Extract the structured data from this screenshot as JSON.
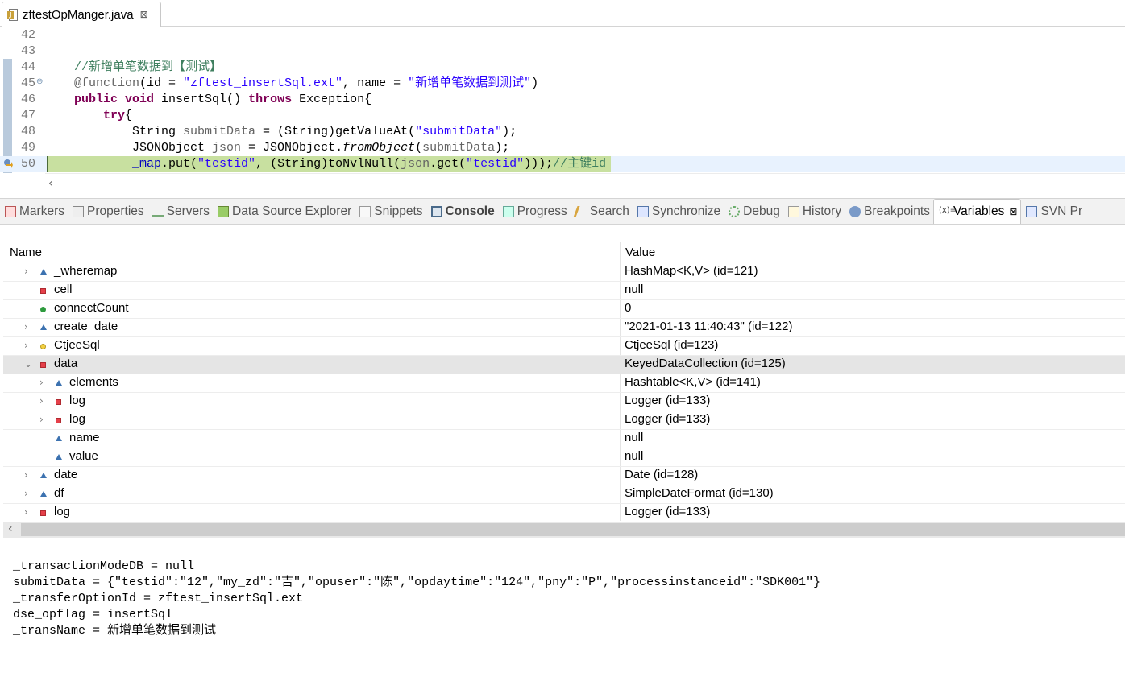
{
  "editor": {
    "tab_title": "zftestOpManger.java",
    "tab_close": "⊠"
  },
  "code": [
    {
      "ln": "42",
      "segments": []
    },
    {
      "ln": "43",
      "segments": []
    },
    {
      "ln": "44",
      "segments": [
        {
          "c": "cmt",
          "t": "//新增单笔数据到【测试】"
        }
      ]
    },
    {
      "ln": "45",
      "fold": "⊖",
      "segments": [
        {
          "c": "ann",
          "t": "@function"
        },
        {
          "c": "",
          "t": "(id = "
        },
        {
          "c": "str",
          "t": "\"zftest_insertSql.ext\""
        },
        {
          "c": "",
          "t": ", name = "
        },
        {
          "c": "str",
          "t": "\"新增单笔数据到测试\""
        },
        {
          "c": "",
          "t": ")"
        }
      ]
    },
    {
      "ln": "46",
      "segments": [
        {
          "c": "kw",
          "t": "public"
        },
        {
          "c": "",
          "t": " "
        },
        {
          "c": "kw",
          "t": "void"
        },
        {
          "c": "",
          "t": " insertSql() "
        },
        {
          "c": "kw",
          "t": "throws"
        },
        {
          "c": "",
          "t": " Exception{"
        }
      ]
    },
    {
      "ln": "47",
      "segments": [
        {
          "c": "",
          "t": "    "
        },
        {
          "c": "kw",
          "t": "try"
        },
        {
          "c": "",
          "t": "{"
        }
      ]
    },
    {
      "ln": "48",
      "segments": [
        {
          "c": "",
          "t": "        String "
        },
        {
          "c": "ann",
          "t": "submitData"
        },
        {
          "c": "",
          "t": " = (String)getValueAt("
        },
        {
          "c": "str",
          "t": "\"submitData\""
        },
        {
          "c": "",
          "t": ");"
        }
      ]
    },
    {
      "ln": "49",
      "segments": [
        {
          "c": "",
          "t": "        JSONObject "
        },
        {
          "c": "ann",
          "t": "json"
        },
        {
          "c": "",
          "t": " = JSONObject."
        },
        {
          "c": "itl",
          "t": "fromObject"
        },
        {
          "c": "",
          "t": "("
        },
        {
          "c": "ann",
          "t": "submitData"
        },
        {
          "c": "",
          "t": ");"
        }
      ]
    },
    {
      "ln": "50",
      "current": true,
      "segments": [
        {
          "c": "",
          "t": "        "
        },
        {
          "c": "fld",
          "t": "_map"
        },
        {
          "c": "",
          "t": ".put("
        },
        {
          "c": "str",
          "t": "\"testid\""
        },
        {
          "c": "",
          "t": ", (String)toNvlNull("
        },
        {
          "c": "ann",
          "t": "json"
        },
        {
          "c": "",
          "t": ".get("
        },
        {
          "c": "str",
          "t": "\"testid\""
        },
        {
          "c": "",
          "t": ")));"
        },
        {
          "c": "cmt",
          "t": "//主键id"
        }
      ]
    }
  ],
  "views": {
    "tabs": [
      {
        "label": "Markers",
        "icon": "markers-icon",
        "cls": "vi-markers"
      },
      {
        "label": "Properties",
        "icon": "properties-icon",
        "cls": "vi-props"
      },
      {
        "label": "Servers",
        "icon": "servers-icon",
        "cls": "vi-servers"
      },
      {
        "label": "Data Source Explorer",
        "icon": "data-source-icon",
        "cls": "vi-dse"
      },
      {
        "label": "Snippets",
        "icon": "snippets-icon",
        "cls": "vi-snip"
      },
      {
        "label": "Console",
        "icon": "console-icon",
        "cls": "vi-console",
        "bold": true
      },
      {
        "label": "Progress",
        "icon": "progress-icon",
        "cls": "vi-progress"
      },
      {
        "label": "Search",
        "icon": "search-icon",
        "cls": "vi-search"
      },
      {
        "label": "Synchronize",
        "icon": "synchronize-icon",
        "cls": "vi-sync"
      },
      {
        "label": "Debug",
        "icon": "debug-icon",
        "cls": "vi-debug"
      },
      {
        "label": "History",
        "icon": "history-icon",
        "cls": "vi-history"
      },
      {
        "label": "Breakpoints",
        "icon": "breakpoints-icon",
        "cls": "vi-bp"
      },
      {
        "label": "Variables",
        "icon": "variables-icon",
        "cls": "vi-vars",
        "glyph": "(x)=",
        "active": true,
        "close": "⊠"
      },
      {
        "label": "SVN Pr",
        "icon": "svn-icon",
        "cls": "vi-svn"
      }
    ]
  },
  "variables": {
    "col_name": "Name",
    "col_value": "Value",
    "rows": [
      {
        "depth": 0,
        "twisty": "›",
        "icon": "tri",
        "name": "_wheremap",
        "value": "HashMap<K,V>  (id=121)"
      },
      {
        "depth": 0,
        "twisty": "",
        "icon": "sq",
        "name": "cell",
        "value": "null"
      },
      {
        "depth": 0,
        "twisty": "",
        "icon": "dot",
        "name": "connectCount",
        "value": "0"
      },
      {
        "depth": 0,
        "twisty": "›",
        "icon": "tri",
        "name": "create_date",
        "value": "\"2021-01-13 11:40:43\" (id=122)"
      },
      {
        "depth": 0,
        "twisty": "›",
        "icon": "pdot",
        "name": "CtjeeSql",
        "value": "CtjeeSql  (id=123)"
      },
      {
        "depth": 0,
        "twisty": "⌄",
        "icon": "sq",
        "name": "data",
        "value": "KeyedDataCollection  (id=125)",
        "selected": true
      },
      {
        "depth": 1,
        "twisty": "›",
        "icon": "tri",
        "name": "elements",
        "value": "Hashtable<K,V>  (id=141)"
      },
      {
        "depth": 1,
        "twisty": "›",
        "icon": "sq",
        "name": "log",
        "value": "Logger  (id=133)"
      },
      {
        "depth": 1,
        "twisty": "›",
        "icon": "sq",
        "name": "log",
        "value": "Logger  (id=133)"
      },
      {
        "depth": 1,
        "twisty": "",
        "icon": "tri",
        "name": "name",
        "value": "null"
      },
      {
        "depth": 1,
        "twisty": "",
        "icon": "tri",
        "name": "value",
        "value": "null"
      },
      {
        "depth": 0,
        "twisty": "›",
        "icon": "tri",
        "name": "date",
        "value": "Date  (id=128)"
      },
      {
        "depth": 0,
        "twisty": "›",
        "icon": "tri",
        "name": "df",
        "value": "SimpleDateFormat  (id=130)"
      },
      {
        "depth": 0,
        "twisty": "›",
        "icon": "sq",
        "name": "log",
        "value": "Logger  (id=133)"
      }
    ],
    "scroll_left_arrow": "‹"
  },
  "detail": {
    "lines": [
      "_transactionModeDB = null",
      "submitData = {\"testid\":\"12\",\"my_zd\":\"吉\",\"opuser\":\"陈\",\"opdaytime\":\"124\",\"pny\":\"P\",\"processinstanceid\":\"SDK001\"}",
      "_transferOptionId = zftest_insertSql.ext",
      "dse_opflag = insertSql",
      "_transName = 新增单笔数据到测试"
    ]
  }
}
